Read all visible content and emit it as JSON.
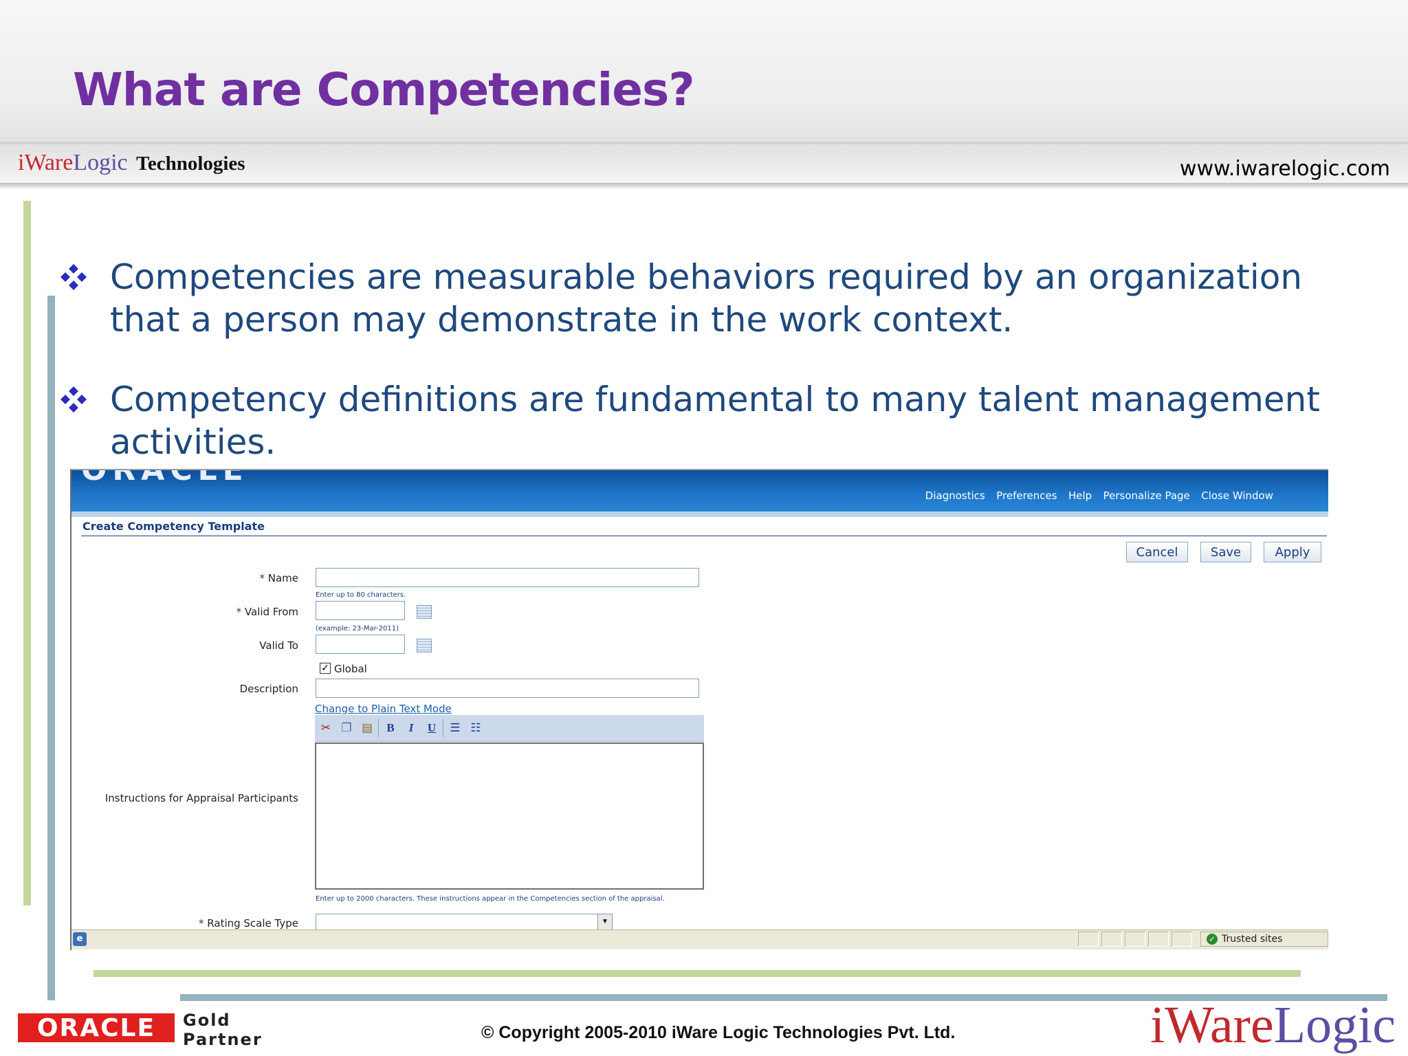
{
  "slide": {
    "title": "What are Competencies?",
    "brand": {
      "i": "i",
      "ware": "Ware",
      "logic": "Logic",
      "technologies": "Technologies"
    },
    "url": "www.iwarelogic.com",
    "bullets": [
      {
        "text": "Competencies are measurable behaviors required by an organization that a person may demonstrate in the work context."
      },
      {
        "text": "Competency definitions are fundamental to many talent management activities."
      }
    ],
    "footer": {
      "oracle": "ORACLE",
      "partner_line1": "Gold",
      "partner_line2": "Partner",
      "copyright": "© Copyright 2005-2010 iWare Logic Technologies Pvt. Ltd."
    },
    "colors": {
      "title": "#7030a0",
      "bullet_text": "#1f497d",
      "bar_green": "#c3d69b",
      "bar_blue": "#93b3bd"
    }
  },
  "app": {
    "logo_text": "ORACLE",
    "global_nav": [
      "Diagnostics",
      "Preferences",
      "Help",
      "Personalize Page",
      "Close Window"
    ],
    "page_heading": "Create Competency Template",
    "buttons": {
      "cancel": "Cancel",
      "save": "Save",
      "apply": "Apply"
    },
    "form": {
      "required_marker": "* ",
      "name": {
        "label": "Name",
        "value": "",
        "hint": "Enter up to 80 characters."
      },
      "valid_from": {
        "label": "Valid From",
        "value": "",
        "hint": "(example: 23-Mar-2011)"
      },
      "valid_to": {
        "label": "Valid To",
        "value": ""
      },
      "global": {
        "label": "Global",
        "checked": true
      },
      "description": {
        "label": "Description",
        "value": ""
      },
      "plain_text_link": "Change to Plain Text Mode",
      "instructions": {
        "label": "Instructions for Appraisal Participants",
        "value": "",
        "hint": "Enter up to 2000 characters. These instructions appear in the Competencies section of the appraisal."
      },
      "rating_scale": {
        "label": "Rating Scale Type",
        "value": ""
      }
    },
    "toolbar_icons": [
      "cut-icon",
      "copy-icon",
      "paste-icon",
      "bold-icon",
      "italic-icon",
      "underline-icon",
      "numbered-list-icon",
      "bulleted-list-icon"
    ],
    "status_zone": "Trusted sites"
  }
}
